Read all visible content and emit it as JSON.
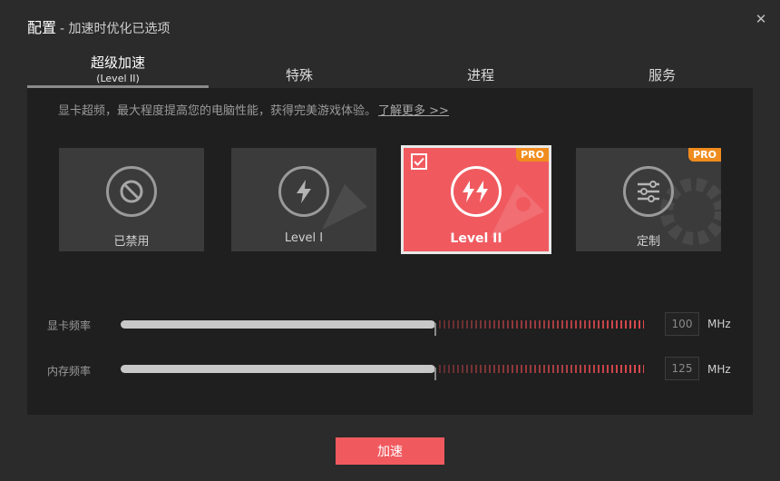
{
  "window": {
    "title": "配置",
    "subtitle": "- 加速时优化已选项",
    "close_icon": "close-icon"
  },
  "tabs": [
    {
      "label": "超级加速",
      "sublabel": "(Level II)",
      "active": true
    },
    {
      "label": "特殊",
      "active": false
    },
    {
      "label": "进程",
      "active": false
    },
    {
      "label": "服务",
      "active": false
    }
  ],
  "description": {
    "text": "显卡超频，最大程度提高您的电脑性能，获得完美游戏体验。",
    "link": "了解更多 >>"
  },
  "cards": [
    {
      "label": "已禁用",
      "icon": "ban-icon",
      "selected": false,
      "pro": false
    },
    {
      "label": "Level I",
      "icon": "lightning-icon",
      "selected": false,
      "pro": false
    },
    {
      "label": "Level II",
      "icon": "double-lightning-icon",
      "selected": true,
      "pro": true,
      "badge": "PRO"
    },
    {
      "label": "定制",
      "icon": "sliders-icon",
      "selected": false,
      "pro": true,
      "badge": "PRO"
    }
  ],
  "sliders": [
    {
      "label": "显卡频率",
      "value": "100",
      "unit": "MHz",
      "fill": 0.6
    },
    {
      "label": "内存频率",
      "value": "125",
      "unit": "MHz",
      "fill": 0.6
    }
  ],
  "action": {
    "label": "加速"
  },
  "colors": {
    "accent": "#f05a5f",
    "pro_badge": "#f08c1e",
    "background": "#2b2b2b",
    "panel": "#1f1f1f"
  }
}
